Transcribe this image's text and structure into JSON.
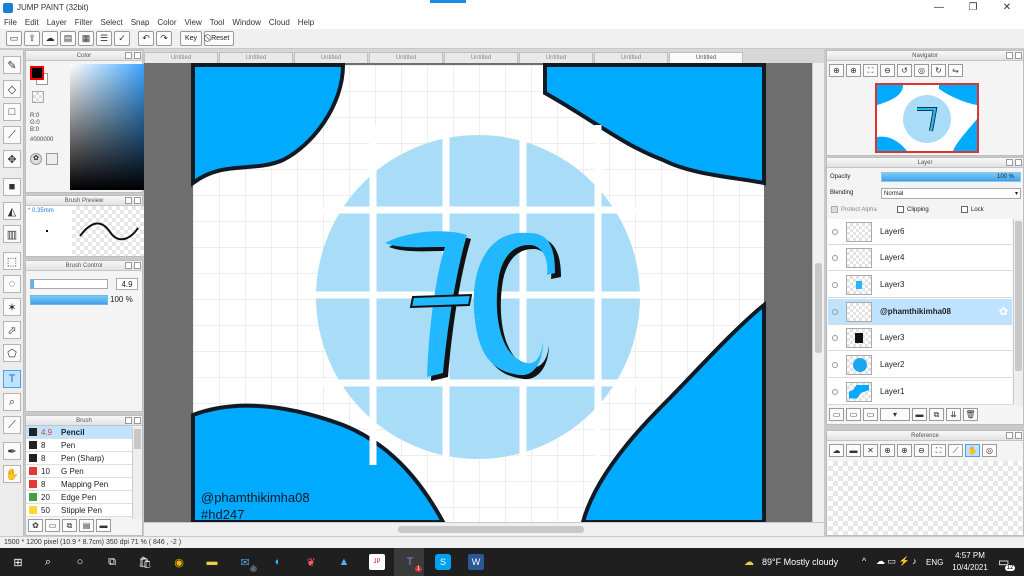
{
  "window": {
    "title": "JUMP PAINT (32bit)",
    "minimize": "—",
    "restore": "❐",
    "close": "✕"
  },
  "menu": [
    "File",
    "Edit",
    "Layer",
    "Filter",
    "Select",
    "Snap",
    "Color",
    "View",
    "Tool",
    "Window",
    "Cloud",
    "Help"
  ],
  "toolbar": {
    "key_label": "Key",
    "reset_label": "Reset"
  },
  "color_panel": {
    "title": "Color",
    "r": "R:0",
    "g": "G:0",
    "b": "B:0",
    "hex": "#000000"
  },
  "brush_preview": {
    "title": "Brush Preview",
    "size": "0.35mm"
  },
  "brush_control": {
    "title": "Brush Control",
    "size_value": "4.9",
    "opacity_value": "100 %"
  },
  "brush_panel": {
    "title": "Brush",
    "items": [
      {
        "size": "4.9",
        "name": "Pencil",
        "color": "#222222"
      },
      {
        "size": "8",
        "name": "Pen",
        "color": "#222222"
      },
      {
        "size": "8",
        "name": "Pen (Sharp)",
        "color": "#222222"
      },
      {
        "size": "10",
        "name": "G Pen",
        "color": "#e53935"
      },
      {
        "size": "8",
        "name": "Mapping Pen",
        "color": "#e53935"
      },
      {
        "size": "20",
        "name": "Edge Pen",
        "color": "#43a047"
      },
      {
        "size": "50",
        "name": "Stipple Pen",
        "color": "#fdd835"
      }
    ]
  },
  "tabs": [
    "Untitled",
    "Untitled",
    "Untitled",
    "Untitled",
    "Untitled",
    "Untitled",
    "Untitled",
    "Untitled"
  ],
  "artwork": {
    "logo": "7C",
    "handle": "@phamthikimha08",
    "tag": "#hd247",
    "blue": "#00aaff",
    "light_blue": "#a9ddf7"
  },
  "statusbar": {
    "text": "1500 * 1200 pixel   (10.9 * 8.7cm)   350 dpi   71 %   ( 846 , -2 )"
  },
  "navigator": {
    "title": "Navigator"
  },
  "layer_panel": {
    "title": "Layer",
    "opacity_label": "Opacity",
    "opacity_value": "100 %",
    "blending_label": "Blending",
    "blending_value": "Normal",
    "protect_alpha": "Protect Alpha",
    "clipping": "Clipping",
    "lock": "Lock",
    "layers": [
      {
        "name": "Layer6",
        "selected": false
      },
      {
        "name": "Layer4",
        "selected": false
      },
      {
        "name": "Layer3",
        "selected": false
      },
      {
        "name": "@phamthikimha08",
        "selected": true
      },
      {
        "name": "Layer3",
        "selected": false
      },
      {
        "name": "Layer2",
        "selected": false
      },
      {
        "name": "Layer1",
        "selected": false
      }
    ]
  },
  "reference": {
    "title": "Reference"
  },
  "taskbar": {
    "weather": "89°F  Mostly cloudy",
    "lang": "ENG",
    "time": "4:57 PM",
    "date": "10/4/2021",
    "notification_count": "12",
    "mail_badge": "2",
    "teams_badge": "1"
  }
}
